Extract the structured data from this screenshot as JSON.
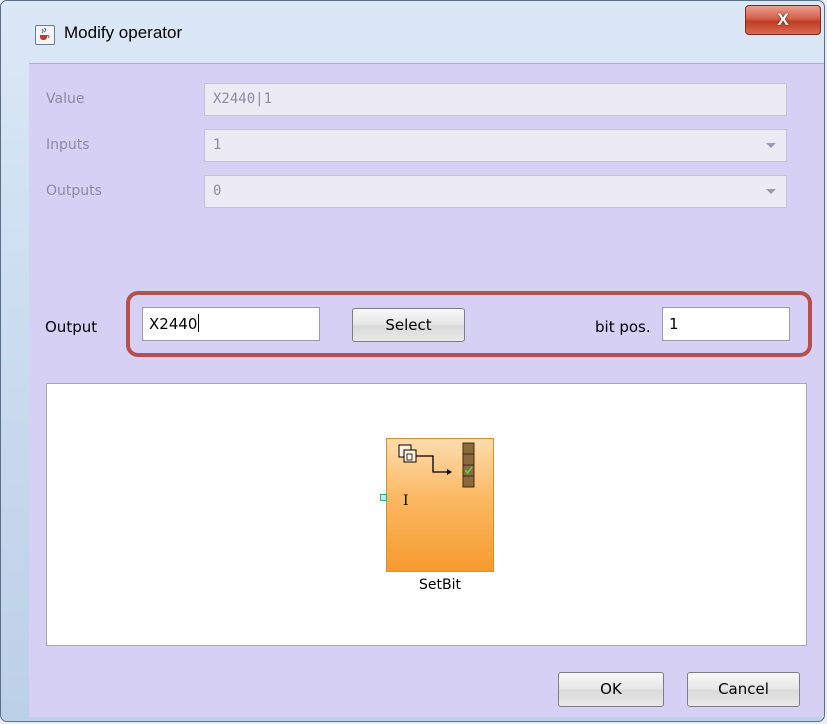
{
  "window": {
    "title": "Modify operator",
    "close_glyph": "X",
    "icon": "java-cup-icon"
  },
  "form": {
    "value_label": "Value",
    "value": "X2440|1",
    "inputs_label": "Inputs",
    "inputs_value": "1",
    "outputs_label": "Outputs",
    "outputs_value": "0"
  },
  "output_row": {
    "label": "Output",
    "value": "X2440",
    "select_label": "Select",
    "bitpos_label": "bit pos.",
    "bitpos_value": "1"
  },
  "diagram": {
    "block_name": "SetBit",
    "input_label": "I"
  },
  "footer": {
    "ok_label": "OK",
    "cancel_label": "Cancel"
  },
  "colors": {
    "panel": "#d6d0f5",
    "highlight": "#b5504e",
    "block_orange": "#f79a2e",
    "close_red": "#c23d25"
  }
}
